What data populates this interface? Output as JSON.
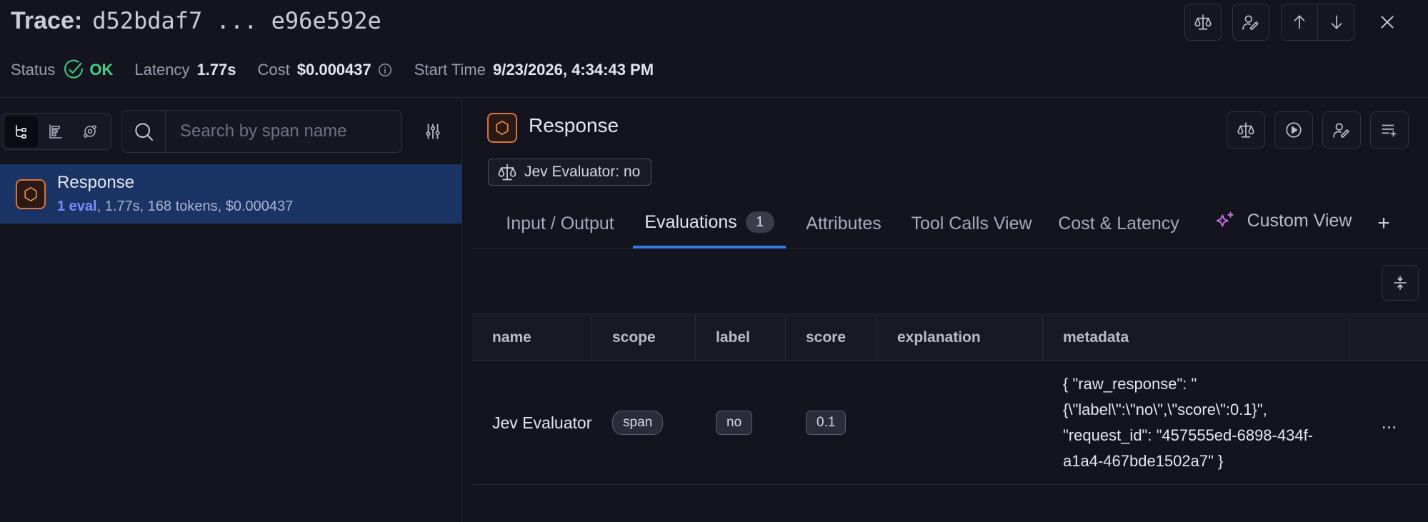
{
  "header": {
    "title_label": "Trace:",
    "trace_id": "d52bdaf7 ... e96e592e",
    "status_label": "Status",
    "status_value": "OK",
    "latency_label": "Latency",
    "latency_value": "1.77s",
    "cost_label": "Cost",
    "cost_value": "$0.000437",
    "start_time_label": "Start Time",
    "start_time_value": "9/23/2026, 4:34:43 PM"
  },
  "left_pane": {
    "search_placeholder": "Search by span name",
    "spans": [
      {
        "name": "Response",
        "eval_count": "1 eval",
        "details": ", 1.77s, 168 tokens, $0.000437"
      }
    ]
  },
  "right_pane": {
    "span_title": "Response",
    "eval_badge": "Jev Evaluator: no",
    "tabs": [
      {
        "label": "Input / Output"
      },
      {
        "label": "Evaluations",
        "count": "1"
      },
      {
        "label": "Attributes"
      },
      {
        "label": "Tool Calls View"
      },
      {
        "label": "Cost & Latency"
      },
      {
        "label": "Custom View"
      }
    ],
    "add_tab": "+",
    "table": {
      "columns": [
        "name",
        "scope",
        "label",
        "score",
        "explanation",
        "metadata"
      ],
      "rows": [
        {
          "name": "Jev Evaluator",
          "scope": "span",
          "label": "no",
          "score": "0.1",
          "explanation": "",
          "metadata": "{ \"raw_response\": \"{\\\"label\\\":\\\"no\\\",\\\"score\\\":0.1}\", \"request_id\": \"457555ed-6898-434f-a1a4-467bde1502a7\" }"
        }
      ],
      "row_menu": "..."
    }
  },
  "colors": {
    "background": "#13141d",
    "accent_blue": "#2f7ce8",
    "selected_row": "#1a3466",
    "status_ok": "#3fd18a",
    "span_icon": "#ef8f4a",
    "custom_view_icon": "#c86fe8",
    "eval_link": "#7b8cff"
  },
  "icons": [
    "scale-icon",
    "annotate-user-icon",
    "arrow-up-icon",
    "arrow-down-icon",
    "close-icon",
    "check-circle-icon",
    "info-icon",
    "tree-view-icon",
    "timeline-view-icon",
    "graph-view-icon",
    "search-icon",
    "filter-sliders-icon",
    "hexagon-span-icon",
    "play-icon",
    "list-add-icon",
    "custom-view-sparkle-icon",
    "collapse-icon"
  ]
}
